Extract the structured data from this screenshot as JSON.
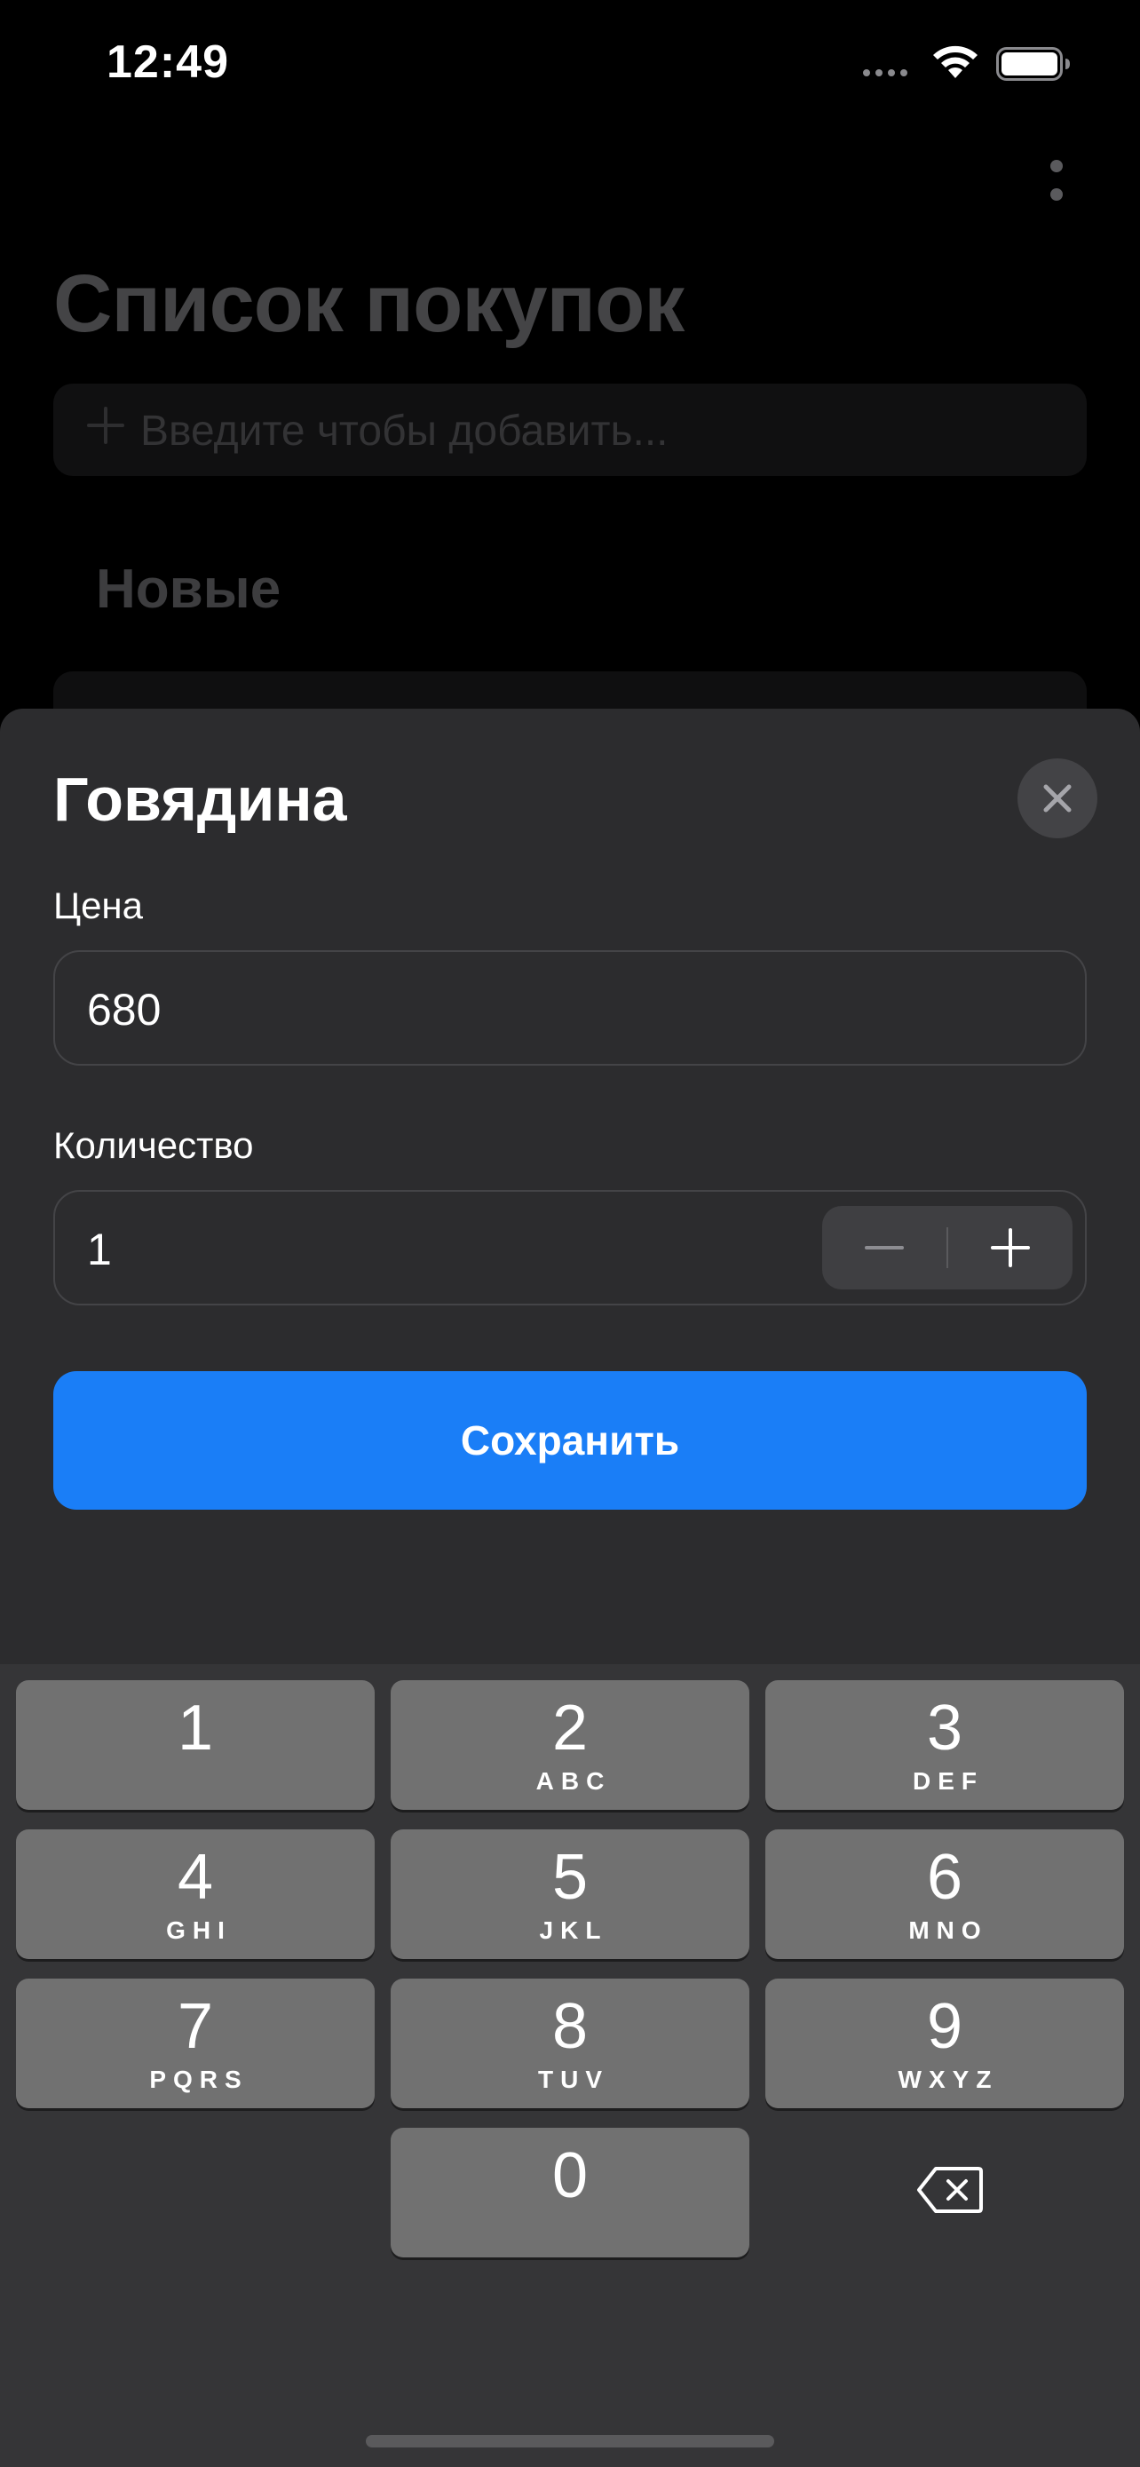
{
  "status_bar": {
    "time": "12:49"
  },
  "background": {
    "title": "Список покупок",
    "add_placeholder": "Введите чтобы добавить...",
    "section_title": "Новые"
  },
  "sheet": {
    "title": "Говядина",
    "price": {
      "label": "Цена",
      "value": "680"
    },
    "quantity": {
      "label": "Количество",
      "value": "1"
    },
    "save_label": "Сохранить"
  },
  "keypad": {
    "keys": [
      {
        "digit": "1",
        "letters": ""
      },
      {
        "digit": "2",
        "letters": "ABC"
      },
      {
        "digit": "3",
        "letters": "DEF"
      },
      {
        "digit": "4",
        "letters": "GHI"
      },
      {
        "digit": "5",
        "letters": "JKL"
      },
      {
        "digit": "6",
        "letters": "MNO"
      },
      {
        "digit": "7",
        "letters": "PQRS"
      },
      {
        "digit": "8",
        "letters": "TUV"
      },
      {
        "digit": "9",
        "letters": "WXYZ"
      },
      {
        "digit": "0",
        "letters": ""
      }
    ]
  },
  "colors": {
    "accent": "#1a7ef7",
    "sheet_background": "#2c2c2e",
    "keypad_background": "#353537",
    "key_background": "#717171"
  },
  "icons": {
    "close": "close-icon",
    "more": "more-vertical-icon",
    "plus": "plus-icon",
    "minus": "minus-icon",
    "delete": "backspace-icon"
  }
}
